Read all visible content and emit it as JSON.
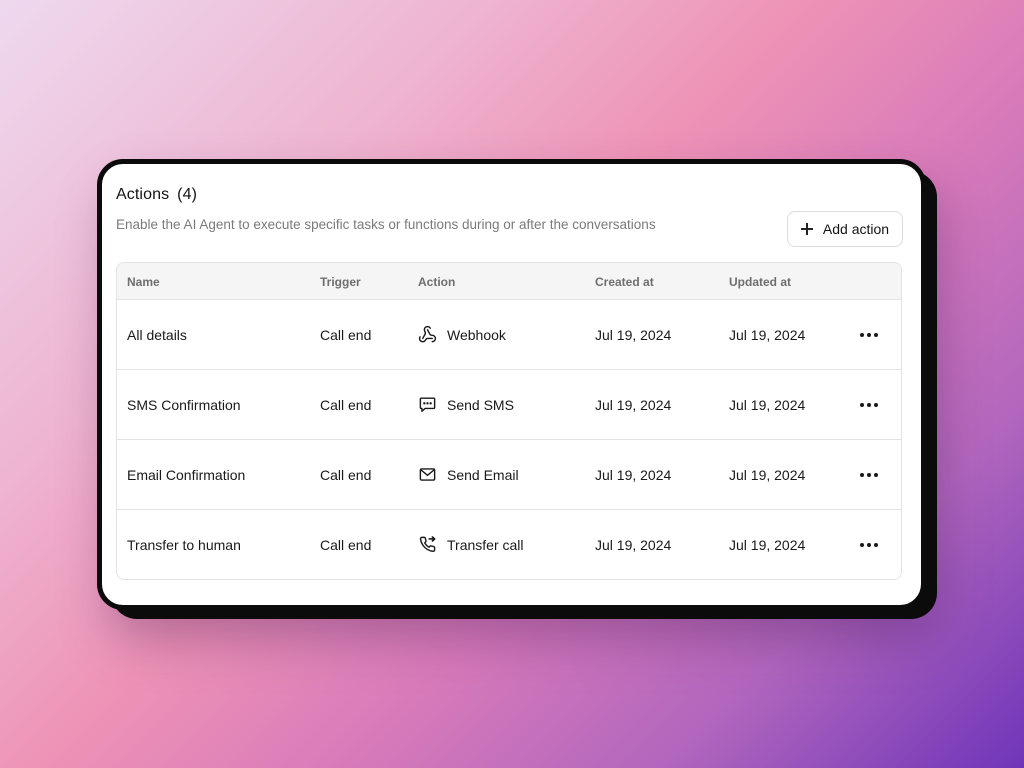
{
  "header": {
    "title": "Actions",
    "count": "(4)",
    "subtitle": "Enable the AI Agent to execute specific tasks or functions during or after the conversations",
    "add_button_label": "Add action"
  },
  "table": {
    "columns": {
      "name": "Name",
      "trigger": "Trigger",
      "action": "Action",
      "created": "Created at",
      "updated": "Updated at"
    },
    "rows": [
      {
        "name": "All details",
        "trigger": "Call end",
        "action": "Webhook",
        "action_icon": "webhook-icon",
        "created": "Jul 19, 2024",
        "updated": "Jul 19, 2024"
      },
      {
        "name": "SMS Confirmation",
        "trigger": "Call end",
        "action": "Send SMS",
        "action_icon": "sms-icon",
        "created": "Jul 19, 2024",
        "updated": "Jul 19, 2024"
      },
      {
        "name": "Email Confirmation",
        "trigger": "Call end",
        "action": "Send Email",
        "action_icon": "email-icon",
        "created": "Jul 19, 2024",
        "updated": "Jul 19, 2024"
      },
      {
        "name": "Transfer to human",
        "trigger": "Call end",
        "action": "Transfer call",
        "action_icon": "transfer-call-icon",
        "created": "Jul 19, 2024",
        "updated": "Jul 19, 2024"
      }
    ]
  }
}
